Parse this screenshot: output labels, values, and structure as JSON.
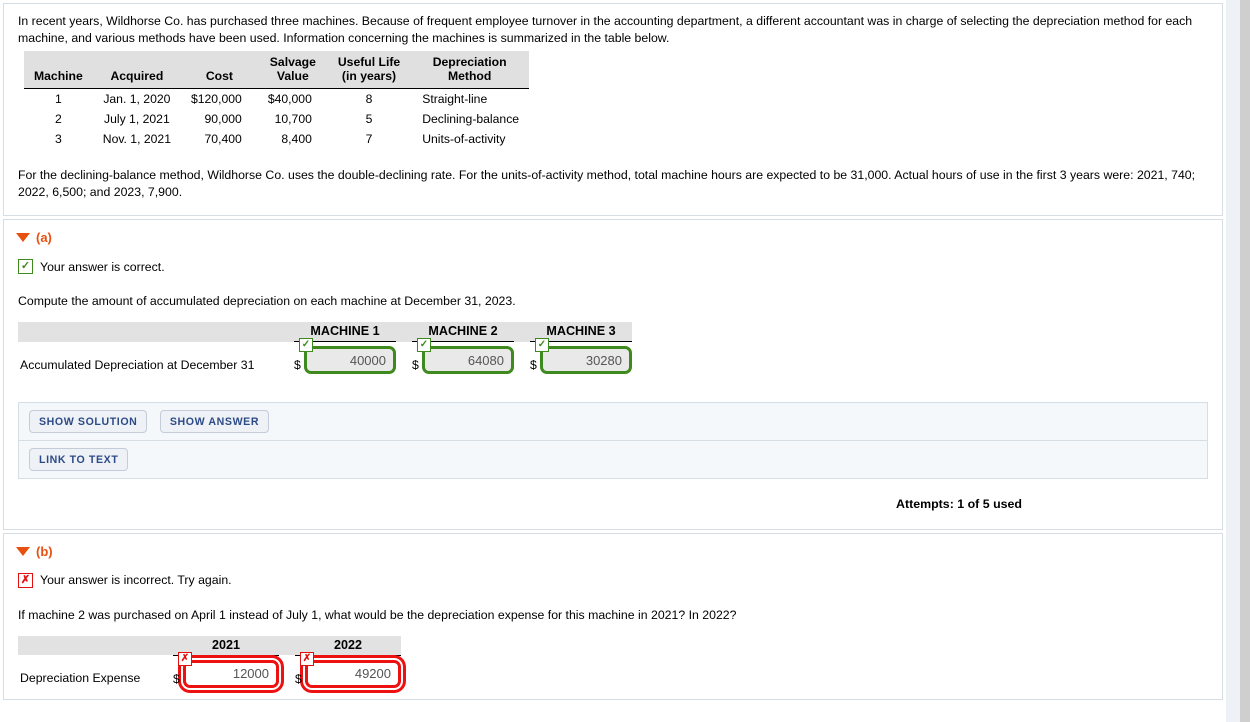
{
  "intro": {
    "paragraph1": "In recent years, Wildhorse Co. has purchased three machines. Because of frequent employee turnover in the accounting department, a different accountant was in charge of selecting the depreciation method for each machine, and various methods have been used. Information concerning the machines is summarized in the table below.",
    "paragraph2": "For the declining-balance method, Wildhorse Co. uses the double-declining rate. For the units-of-activity method, total machine hours are expected to be 31,000. Actual hours of use in the first 3 years were: 2021, 740; 2022, 6,500; and 2023, 7,900."
  },
  "machine_table": {
    "headers": {
      "machine": "Machine",
      "acquired": "Acquired",
      "cost": "Cost",
      "salvage_line1": "Salvage",
      "salvage_line2": "Value",
      "life_line1": "Useful Life",
      "life_line2": "(in years)",
      "method_line1": "Depreciation",
      "method_line2": "Method"
    },
    "rows": [
      {
        "machine": "1",
        "acquired": "Jan. 1, 2020",
        "cost": "$120,000",
        "salvage": "$40,000",
        "life": "8",
        "method": "Straight-line"
      },
      {
        "machine": "2",
        "acquired": "July 1, 2021",
        "cost": "90,000",
        "salvage": "10,700",
        "life": "5",
        "method": "Declining-balance"
      },
      {
        "machine": "3",
        "acquired": "Nov. 1, 2021",
        "cost": "70,400",
        "salvage": "8,400",
        "life": "7",
        "method": "Units-of-activity"
      }
    ]
  },
  "section_a": {
    "label": "(a)",
    "status_icon": "check-icon",
    "status_mark": "✓",
    "status_text": "Your answer is correct.",
    "prompt": "Compute the amount of accumulated depreciation on each machine at December 31, 2023.",
    "row_label": "Accumulated Depreciation at December 31",
    "columns": [
      {
        "header": "MACHINE 1",
        "value": "40000",
        "mark": "✓"
      },
      {
        "header": "MACHINE 2",
        "value": "64080",
        "mark": "✓"
      },
      {
        "header": "MACHINE 3",
        "value": "30280",
        "mark": "✓"
      }
    ],
    "currency_symbol": "$",
    "buttons": {
      "show_solution": "SHOW SOLUTION",
      "show_answer": "SHOW ANSWER",
      "link_to_text": "LINK TO TEXT"
    },
    "attempts": "Attempts: 1 of 5 used"
  },
  "section_b": {
    "label": "(b)",
    "status_icon": "x-icon",
    "status_mark": "✗",
    "status_text": "Your answer is incorrect.  Try again.",
    "prompt": "If machine 2 was purchased on April 1 instead of July 1, what would be the depreciation expense for this machine in 2021? In 2022?",
    "row_label": "Depreciation Expense",
    "columns": [
      {
        "header": "2021",
        "value": "12000",
        "mark": "✗"
      },
      {
        "header": "2022",
        "value": "49200",
        "mark": "✗"
      }
    ],
    "currency_symbol": "$"
  },
  "colors": {
    "accent": "#e8500f",
    "correct": "#3f8a1f",
    "incorrect": "#ee1111",
    "button_text": "#2c4a86"
  }
}
